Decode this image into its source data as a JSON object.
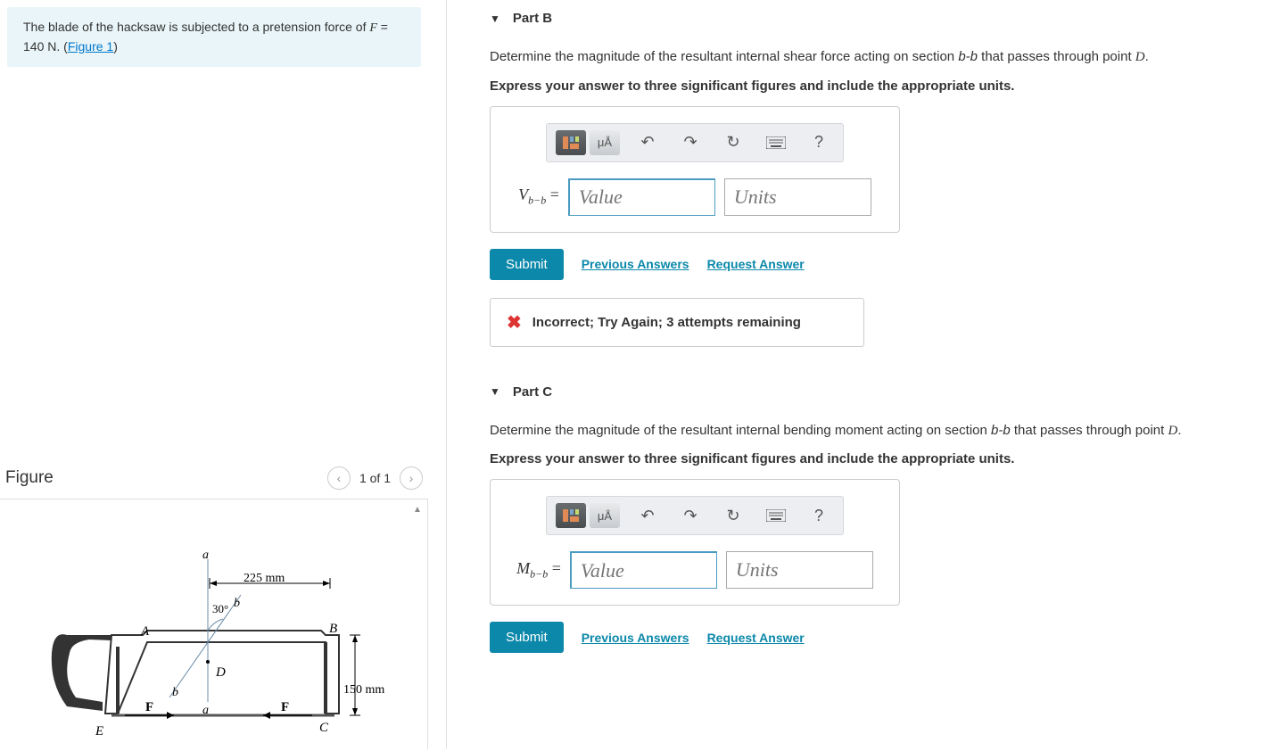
{
  "problem": {
    "text_before_f": "The blade of the hacksaw is subjected to a pretension force of ",
    "f_var": "F",
    "f_eq": " = 140 ",
    "unit_n": "N",
    "period": ". (",
    "figure_link": "Figure 1",
    "close_paren": ")"
  },
  "figure": {
    "title": "Figure",
    "nav_label": "1 of 1",
    "dims": {
      "a": "a",
      "b": "b",
      "A": "A",
      "B": "B",
      "C": "C",
      "D": "D",
      "E": "E",
      "F": "F",
      "225mm": "225 mm",
      "150mm": "150 mm",
      "30deg": "30°"
    }
  },
  "toolbar": {
    "mu_a": "μÅ",
    "help": "?"
  },
  "partB": {
    "title": "Part B",
    "prompt_pre": "Determine the magnitude of the resultant internal shear force acting on section ",
    "section": "b-b",
    "prompt_mid": " that passes through point ",
    "point": "D",
    "prompt_end": ".",
    "instr": "Express your answer to three significant figures and include the appropriate units.",
    "var_prefix_i": "V",
    "var_sub": "b−b",
    "var_eq": " =",
    "value_ph": "Value",
    "units_ph": "Units",
    "submit": "Submit",
    "prev": "Previous Answers",
    "req": "Request Answer",
    "feedback": "Incorrect; Try Again; 3 attempts remaining"
  },
  "partC": {
    "title": "Part C",
    "prompt_pre": "Determine the magnitude of the resultant internal bending moment acting on section ",
    "section": "b-b",
    "prompt_mid": " that passes through point ",
    "point": "D",
    "prompt_end": ".",
    "instr": "Express your answer to three significant figures and include the appropriate units.",
    "var_prefix_i": "M",
    "var_sub": "b−b",
    "var_eq": " =",
    "value_ph": "Value",
    "units_ph": "Units",
    "submit": "Submit",
    "prev": "Previous Answers",
    "req": "Request Answer"
  }
}
